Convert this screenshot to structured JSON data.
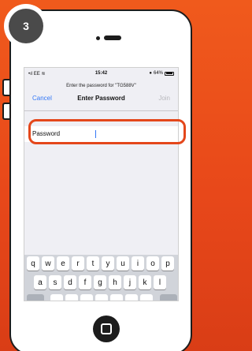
{
  "step": {
    "number": "3"
  },
  "status_bar": {
    "carrier": "EE",
    "time": "15:42",
    "battery": "64%"
  },
  "wifi_prompt": "Enter the password for \"TG588V\"",
  "navbar": {
    "cancel_label": "Cancel",
    "title": "Enter Password",
    "join_label": "Join"
  },
  "password_field": {
    "label": "Password",
    "value": ""
  },
  "keyboard": {
    "row1": [
      "q",
      "w",
      "e",
      "r",
      "t",
      "y",
      "u",
      "i",
      "o",
      "p"
    ],
    "row2": [
      "a",
      "s",
      "d",
      "f",
      "g",
      "h",
      "j",
      "k",
      "l"
    ]
  },
  "colors": {
    "accent": "#e4471b",
    "ios_blue": "#3478f6",
    "background": "#f05a1c"
  }
}
